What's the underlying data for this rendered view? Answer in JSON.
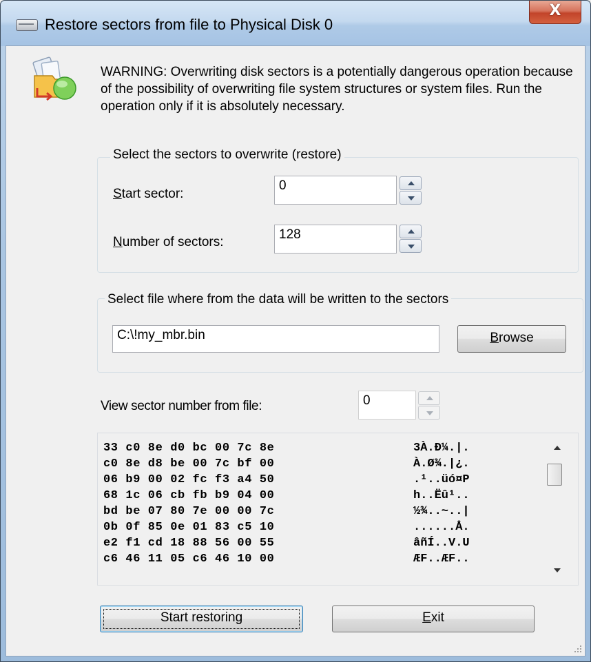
{
  "window": {
    "title": "Restore sectors from file to Physical Disk 0",
    "close_symbol": "X"
  },
  "warning": {
    "icon": "restore-disk-icon",
    "text": "WARNING: Overwriting disk sectors is a potentially dangerous operation because of the possibility of overwriting file system structures or system files. Run the operation only if it is absolutely necessary."
  },
  "sectors_group": {
    "label": "Select the sectors to overwrite (restore)",
    "start_sector": {
      "mnemonic": "S",
      "rest": "tart sector:",
      "value": "0"
    },
    "number_of_sectors": {
      "mnemonic": "N",
      "rest": "umber of sectors:",
      "value": "128"
    }
  },
  "file_group": {
    "label": "Select file where from the data will be written to the sectors",
    "path": "C:\\!my_mbr.bin",
    "browse": {
      "mnemonic": "B",
      "rest": "rowse"
    }
  },
  "view": {
    "label": "View sector number from file:",
    "value": "0"
  },
  "hex_rows": [
    {
      "hex": "33 c0 8e d0 bc 00 7c 8e",
      "ascii": "3À.Ð¼.|."
    },
    {
      "hex": "c0 8e d8 be 00 7c bf 00",
      "ascii": "À.Ø¾.|¿."
    },
    {
      "hex": "06 b9 00 02 fc f3 a4 50",
      "ascii": ".¹..üó¤P"
    },
    {
      "hex": "68 1c 06 cb fb b9 04 00",
      "ascii": "h..Ëû¹.."
    },
    {
      "hex": "bd be 07 80 7e 00 00 7c",
      "ascii": "½¾..~..|"
    },
    {
      "hex": "0b 0f 85 0e 01 83 c5 10",
      "ascii": "......Å."
    },
    {
      "hex": "e2 f1 cd 18 88 56 00 55",
      "ascii": "âñÍ..V.U"
    },
    {
      "hex": "c6 46 11 05 c6 46 10 00",
      "ascii": "ÆF..ÆF.."
    }
  ],
  "buttons": {
    "start": "Start restoring",
    "exit": {
      "mnemonic": "E",
      "rest": "xit"
    }
  }
}
